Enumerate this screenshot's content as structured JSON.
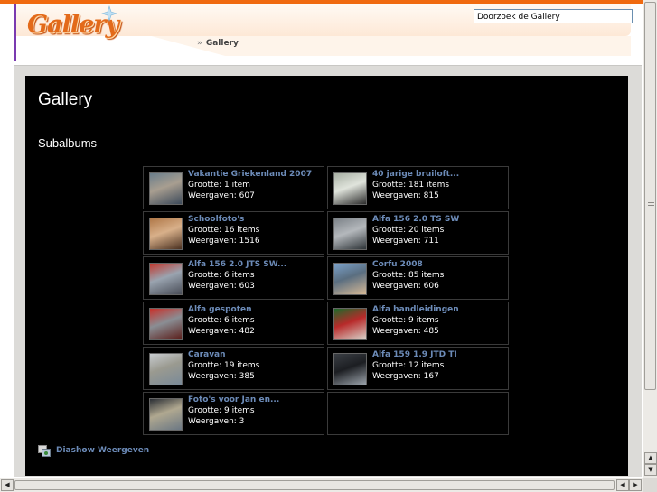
{
  "header": {
    "logo_text": "Gallery",
    "search_value": "Doorzoek de Gallery",
    "breadcrumb_sep": "»",
    "breadcrumb_current": "Gallery"
  },
  "main": {
    "title": "Gallery",
    "section_title": "Subalbums"
  },
  "albums": [
    {
      "name": "Vakantie Griekenland 2007",
      "size": "Grootte: 1 item",
      "views": "Weergaven: 607",
      "thumb_colors": [
        "#6a7e8c",
        "#3c4a5a",
        "#a89e90"
      ]
    },
    {
      "name": "40 jarige bruiloft...",
      "size": "Grootte: 181 items",
      "views": "Weergaven: 815",
      "thumb_colors": [
        "#a8b0a4",
        "#2c2c2c",
        "#e0e4dc"
      ]
    },
    {
      "name": "Schoolfoto's",
      "size": "Grootte: 16 items",
      "views": "Weergaven: 1516",
      "thumb_colors": [
        "#b07848",
        "#4a3020",
        "#d8b08a"
      ]
    },
    {
      "name": "Alfa 156 2.0 TS SW",
      "size": "Grootte: 20 items",
      "views": "Weergaven: 711",
      "thumb_colors": [
        "#7c8288",
        "#2e3438",
        "#b4b8bc"
      ]
    },
    {
      "name": "Alfa 156 2.0 JTS SW...",
      "size": "Grootte: 6 items",
      "views": "Weergaven: 603",
      "thumb_colors": [
        "#c03a30",
        "#4a4e58",
        "#9aa4b0"
      ]
    },
    {
      "name": "Corfu 2008",
      "size": "Grootte: 85 items",
      "views": "Weergaven: 606",
      "thumb_colors": [
        "#7aa0c8",
        "#d4b896",
        "#5a6e80"
      ]
    },
    {
      "name": "Alfa gespoten",
      "size": "Grootte: 6 items",
      "views": "Weergaven: 482",
      "thumb_colors": [
        "#c8302a",
        "#5a1c18",
        "#8a8e94"
      ]
    },
    {
      "name": "Alfa handleidingen",
      "size": "Grootte: 9 items",
      "views": "Weergaven: 485",
      "thumb_colors": [
        "#1c6a2a",
        "#d8d4cc",
        "#b82a2a"
      ]
    },
    {
      "name": "Caravan",
      "size": "Grootte: 19 items",
      "views": "Weergaven: 385",
      "thumb_colors": [
        "#c8ccd0",
        "#7a8a98",
        "#9a9a90"
      ]
    },
    {
      "name": "Alfa 159 1.9 JTD TI",
      "size": "Grootte: 12 items",
      "views": "Weergaven: 167",
      "thumb_colors": [
        "#3a3e44",
        "#9aa2aa",
        "#1c1e22"
      ]
    },
    {
      "name": "Foto's voor Jan en...",
      "size": "Grootte: 9 items",
      "views": "Weergaven: 3",
      "thumb_colors": [
        "#2a2e34",
        "#6c7884",
        "#b0a890"
      ]
    }
  ],
  "slideshow_label": "Diashow Weergeven",
  "colors": {
    "accent_orange": "#f06a10",
    "link_blue": "#6c8bb8",
    "panel_bg": "#000000"
  },
  "icons": {
    "slideshow": "slideshow-icon",
    "scroll_up": "arrow-up-icon",
    "scroll_down": "arrow-down-icon",
    "scroll_left": "arrow-left-icon",
    "scroll_right": "arrow-right-icon"
  }
}
